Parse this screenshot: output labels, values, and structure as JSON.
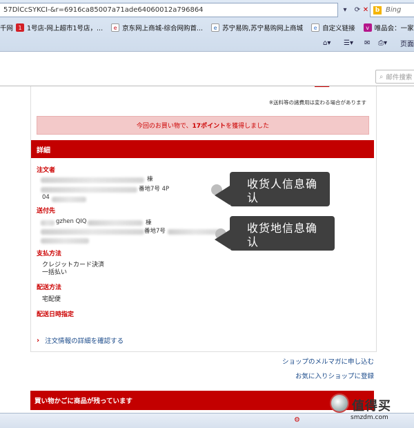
{
  "browser": {
    "url": "57DlCcSYKCI-&r=6916ca85007a71ade64060012a796864",
    "search_placeholder": "Bing",
    "favorites": [
      {
        "label": "1号店-网上超市1号店，...",
        "color": "#d31f26"
      },
      {
        "label": "京东网上商城-综合网购首...",
        "color": "#c81623"
      },
      {
        "label": "苏宁易购,苏宁易购网上商城",
        "color": "#2b6ab5"
      },
      {
        "label": "自定义链接",
        "color": "#3d7ad1"
      },
      {
        "label": "唯品会：一家专门做特卖...",
        "color": "#b5178b"
      }
    ],
    "fav_prefix": "千网",
    "page_menu": "页面"
  },
  "page": {
    "mail_search_placeholder": "邮件搜索",
    "shipping_note": "※送料等の諸費用は変わる場合があります",
    "points": {
      "prefix": "今回のお買い物で、",
      "value": "17ポイント",
      "suffix": "を獲得しました"
    },
    "detail_header": "詳細",
    "orderer_label": "注文者",
    "orderer_fragment_1": "棟",
    "orderer_fragment_2": "番地7号 4P",
    "orderer_fragment_3": "04",
    "recipient_label": "送付先",
    "recipient_fragment_1": "gzhen QIQ",
    "recipient_fragment_2": "棟",
    "recipient_fragment_3": "番地7号",
    "payment_label": "支払方法",
    "payment_value_1": "クレジットカード決済",
    "payment_value_2": "一括払い",
    "delivery_label": "配送方法",
    "delivery_value": "宅配便",
    "delivery_date_label": "配送日時指定",
    "detail_link": "注文情報の詳細を確認する",
    "newsletter_link": "ショップのメルマガに申し込む",
    "favorite_shop_link": "お気に入りショップに登録",
    "cart_notice": "買い物かごに商品が残っています"
  },
  "annotations": {
    "callout_1": "收货人信息确认",
    "callout_2": "收货地信息确认"
  },
  "watermark": {
    "text": "值得买",
    "sub": "smzdm.com"
  }
}
